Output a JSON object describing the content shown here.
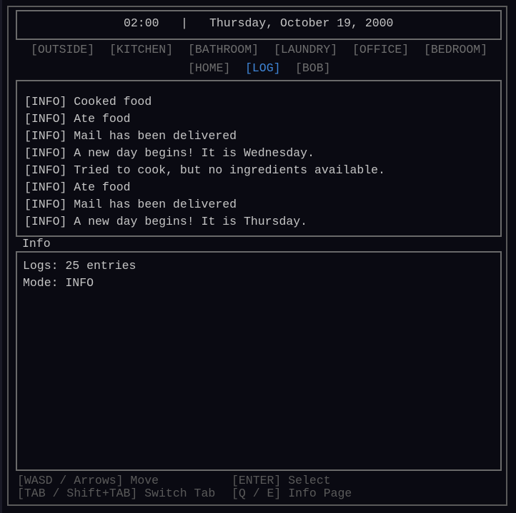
{
  "header": {
    "time": "02:00",
    "separator": "|",
    "date": "Thursday, October 19, 2000"
  },
  "tabs": [
    {
      "label": "[OUTSIDE]",
      "active": false
    },
    {
      "label": "[KITCHEN]",
      "active": false
    },
    {
      "label": "[BATHROOM]",
      "active": false
    },
    {
      "label": "[LAUNDRY]",
      "active": false
    },
    {
      "label": "[OFFICE]",
      "active": false
    },
    {
      "label": "[BEDROOM]",
      "active": false
    },
    {
      "label": "[HOME]",
      "active": false
    },
    {
      "label": "[LOG]",
      "active": true
    },
    {
      "label": "[BOB]",
      "active": false
    }
  ],
  "log": {
    "lines": [
      "[INFO] Cooked food",
      "[INFO] Ate food",
      "[INFO] Mail has been delivered",
      "[INFO] A new day begins! It is Wednesday.",
      "[INFO] Tried to cook, but no ingredients available.",
      "[INFO] Ate food",
      "[INFO] Mail has been delivered",
      "[INFO] A new day begins! It is Thursday."
    ]
  },
  "info": {
    "title": "Info",
    "lines": [
      "Logs: 25 entries",
      "Mode: INFO"
    ]
  },
  "footer": {
    "move": "[WASD / Arrows] Move",
    "select": "[ENTER] Select",
    "switch_tab": "[TAB / Shift+TAB] Switch Tab",
    "info_page": "[Q / E] Info Page"
  },
  "colors": {
    "background": "#0a0a12",
    "active_tab": "#3f86d8",
    "inactive_tab": "#6e6e6e",
    "border": "#6a6a6a"
  }
}
